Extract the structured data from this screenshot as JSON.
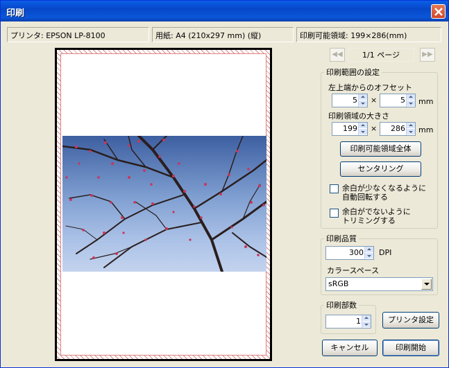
{
  "window": {
    "title": "印刷"
  },
  "info": {
    "printer": "プリンタ: EPSON LP-8100",
    "paper": "用紙: A4 (210x297 mm) (縦)",
    "printable_area": "印刷可能領域: 199×286(mm)"
  },
  "navigation": {
    "prev": "◀◀",
    "page": "1/1 ページ",
    "next": "▶▶"
  },
  "print_range": {
    "legend": "印刷範囲の設定",
    "offset_label": "左上端からのオフセット",
    "offset_x": "5",
    "offset_y": "5",
    "size_label": "印刷領域の大きさ",
    "size_w": "199",
    "size_h": "286",
    "times": "×",
    "unit": "mm",
    "fill_button": "印刷可能領域全体",
    "center_button": "センタリング",
    "auto_rotate_line1": "余白が少なくなるように",
    "auto_rotate_line2": "自動回転する",
    "trim_line1": "余白がでないように",
    "trim_line2": "トリミングする"
  },
  "quality": {
    "legend": "印刷品質",
    "dpi_value": "300",
    "dpi_unit": "DPI",
    "colorspace_label": "カラースペース",
    "colorspace_value": "sRGB"
  },
  "copies": {
    "legend": "印刷部数",
    "value": "1"
  },
  "buttons": {
    "printer_settings": "プリンタ設定",
    "cancel": "キャンセル",
    "print": "印刷開始"
  }
}
